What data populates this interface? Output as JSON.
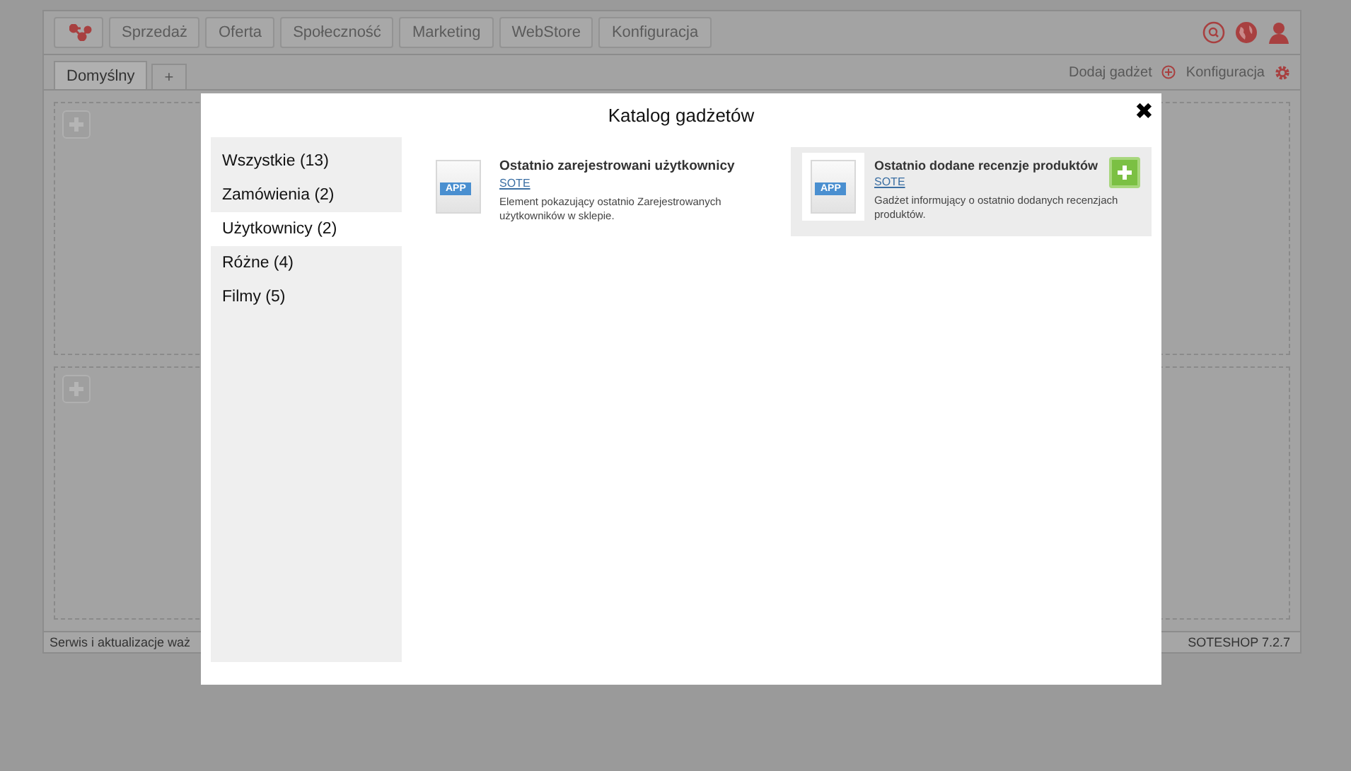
{
  "toolbar": {
    "menu": [
      {
        "label": "Sprzedaż"
      },
      {
        "label": "Oferta"
      },
      {
        "label": "Społeczność"
      },
      {
        "label": "Marketing"
      },
      {
        "label": "WebStore"
      },
      {
        "label": "Konfiguracja"
      }
    ]
  },
  "tabs": [
    {
      "label": "Domyślny",
      "selected": true
    },
    {
      "label": "+",
      "selected": false
    }
  ],
  "actions": {
    "add_gadget": "Dodaj gadżet",
    "configuration": "Konfiguracja"
  },
  "status_bar": {
    "left": "Serwis i aktualizacje waż",
    "right": "SOTESHOP 7.2.7"
  },
  "dialog": {
    "title": "Katalog gadżetów",
    "close": "✖",
    "categories": [
      {
        "label": "Wszystkie (13)",
        "selected": false
      },
      {
        "label": "Zamówienia (2)",
        "selected": false
      },
      {
        "label": "Użytkownicy (2)",
        "selected": true
      },
      {
        "label": "Różne (4)",
        "selected": false
      },
      {
        "label": "Filmy (5)",
        "selected": false
      }
    ],
    "gadgets": [
      {
        "title": "Ostatnio zarejestrowani użytkownicy",
        "author": "SOTE",
        "description": "Element pokazujący ostatnio Zarejestrowanych użytkowników w sklepie.",
        "badge": "APP",
        "selected": false
      },
      {
        "title": "Ostatnio dodane recenzje produktów",
        "author": "SOTE",
        "description": "Gadżet informujący o ostatnio dodanych recenzjach produktów.",
        "badge": "APP",
        "selected": true
      }
    ]
  }
}
